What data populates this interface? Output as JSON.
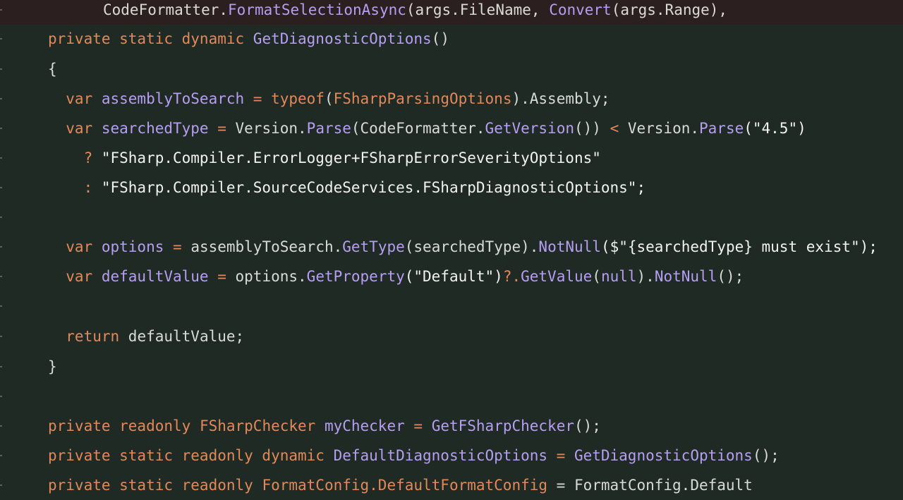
{
  "editor": {
    "lines": [
      {
        "highlight": true,
        "tokens": [
          {
            "t": "CodeFormatter.",
            "c": "tx"
          },
          {
            "t": "FormatSelectionAsync",
            "c": "fn"
          },
          {
            "t": "(args.FileName, ",
            "c": "tx"
          },
          {
            "t": "Convert",
            "c": "fn"
          },
          {
            "t": "(args.Range),",
            "c": "tx"
          }
        ]
      },
      {
        "tokens": [
          {
            "t": "private static dynamic ",
            "c": "kw"
          },
          {
            "t": "GetDiagnosticOptions",
            "c": "fn"
          },
          {
            "t": "()",
            "c": "tx"
          }
        ]
      },
      {
        "tokens": [
          {
            "t": "{",
            "c": "tx"
          }
        ]
      },
      {
        "tokens": [
          {
            "t": "  var ",
            "c": "kw"
          },
          {
            "t": "assemblyToSearch",
            "c": "fn"
          },
          {
            "t": " = ",
            "c": "op"
          },
          {
            "t": "typeof",
            "c": "kw"
          },
          {
            "t": "(",
            "c": "tx"
          },
          {
            "t": "FSharpParsingOptions",
            "c": "ty"
          },
          {
            "t": ").Assembly;",
            "c": "tx"
          }
        ]
      },
      {
        "tokens": [
          {
            "t": "  var ",
            "c": "kw"
          },
          {
            "t": "searchedType",
            "c": "fn"
          },
          {
            "t": " = ",
            "c": "op"
          },
          {
            "t": "Version.",
            "c": "tx"
          },
          {
            "t": "Parse",
            "c": "fn"
          },
          {
            "t": "(CodeFormatter.",
            "c": "tx"
          },
          {
            "t": "GetVersion",
            "c": "fn"
          },
          {
            "t": "()) ",
            "c": "tx"
          },
          {
            "t": "<",
            "c": "op"
          },
          {
            "t": " Version.",
            "c": "tx"
          },
          {
            "t": "Parse",
            "c": "fn"
          },
          {
            "t": "(\"4.5\")",
            "c": "st"
          }
        ]
      },
      {
        "tokens": [
          {
            "t": "    ? ",
            "c": "op"
          },
          {
            "t": "\"FSharp.Compiler.ErrorLogger+FSharpErrorSeverityOptions\"",
            "c": "st"
          }
        ]
      },
      {
        "tokens": [
          {
            "t": "    : ",
            "c": "op"
          },
          {
            "t": "\"FSharp.Compiler.SourceCodeServices.FSharpDiagnosticOptions\";",
            "c": "st"
          }
        ]
      },
      {
        "tokens": []
      },
      {
        "tokens": [
          {
            "t": "  var ",
            "c": "kw"
          },
          {
            "t": "options",
            "c": "fn"
          },
          {
            "t": " = ",
            "c": "op"
          },
          {
            "t": "assemblyToSearch.",
            "c": "tx"
          },
          {
            "t": "GetType",
            "c": "fn"
          },
          {
            "t": "(searchedType).",
            "c": "tx"
          },
          {
            "t": "NotNull",
            "c": "fn"
          },
          {
            "t": "($\"{searchedType} must exist\");",
            "c": "st"
          }
        ]
      },
      {
        "tokens": [
          {
            "t": "  var ",
            "c": "kw"
          },
          {
            "t": "defaultValue",
            "c": "fn"
          },
          {
            "t": " = ",
            "c": "op"
          },
          {
            "t": "options.",
            "c": "tx"
          },
          {
            "t": "GetProperty",
            "c": "fn"
          },
          {
            "t": "(\"Default\")",
            "c": "st"
          },
          {
            "t": "?.",
            "c": "op"
          },
          {
            "t": "GetValue",
            "c": "fn"
          },
          {
            "t": "(",
            "c": "tx"
          },
          {
            "t": "null",
            "c": "nl"
          },
          {
            "t": ").",
            "c": "tx"
          },
          {
            "t": "NotNull",
            "c": "fn"
          },
          {
            "t": "();",
            "c": "tx"
          }
        ]
      },
      {
        "tokens": []
      },
      {
        "tokens": [
          {
            "t": "  return ",
            "c": "kw"
          },
          {
            "t": "defaultValue;",
            "c": "tx"
          }
        ]
      },
      {
        "tokens": [
          {
            "t": "}",
            "c": "tx"
          }
        ]
      },
      {
        "tokens": []
      },
      {
        "tokens": [
          {
            "t": "private readonly ",
            "c": "kw"
          },
          {
            "t": "FSharpChecker ",
            "c": "ty"
          },
          {
            "t": "myChecker",
            "c": "fn"
          },
          {
            "t": " = ",
            "c": "op"
          },
          {
            "t": "GetFSharpChecker",
            "c": "fn"
          },
          {
            "t": "();",
            "c": "tx"
          }
        ]
      },
      {
        "tokens": [
          {
            "t": "private static readonly dynamic ",
            "c": "kw"
          },
          {
            "t": "DefaultDiagnosticOptions",
            "c": "fn"
          },
          {
            "t": " = ",
            "c": "op"
          },
          {
            "t": "GetDiagnosticOptions",
            "c": "fn"
          },
          {
            "t": "();",
            "c": "tx"
          }
        ]
      },
      {
        "tokens": [
          {
            "t": "private static readonly ",
            "c": "kw"
          },
          {
            "t": "FormatConfig.DefaultFormatConfig ",
            "c": "ty"
          },
          {
            "t": "= FormatConfig.Default",
            "c": "tx"
          }
        ]
      }
    ]
  }
}
